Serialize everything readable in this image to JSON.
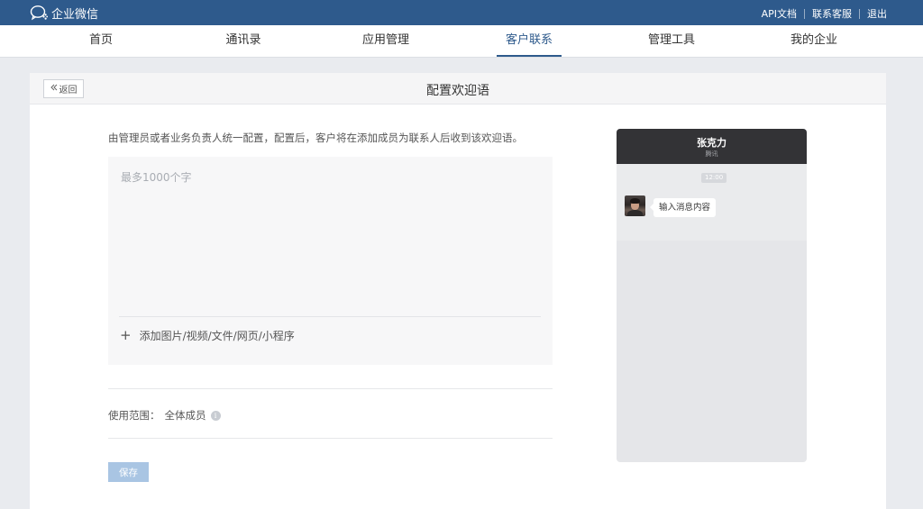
{
  "app": {
    "logo_text": "企业微信",
    "top_links": [
      "API文档",
      "联系客服",
      "退出"
    ]
  },
  "nav": {
    "items": [
      "首页",
      "通讯录",
      "应用管理",
      "客户联系",
      "管理工具",
      "我的企业"
    ],
    "active": "客户联系"
  },
  "page": {
    "back_label": "返回",
    "title": "配置欢迎语",
    "description": "由管理员或者业务负责人统一配置，配置后，客户将在添加成员为联系人后收到该欢迎语。",
    "editor_placeholder": "最多1000个字",
    "attach_label": "添加图片/视频/文件/网页/小程序",
    "scope_label": "使用范围：",
    "scope_value": "全体成员",
    "save_label": "保存"
  },
  "preview": {
    "contact_name": "张克力",
    "contact_org": "腾讯",
    "time": "12:00",
    "message": "输入消息内容"
  },
  "colors": {
    "topbar": "#2e5a8c",
    "accent": "#2e5a8c",
    "save_button": "#a9c5e3"
  }
}
